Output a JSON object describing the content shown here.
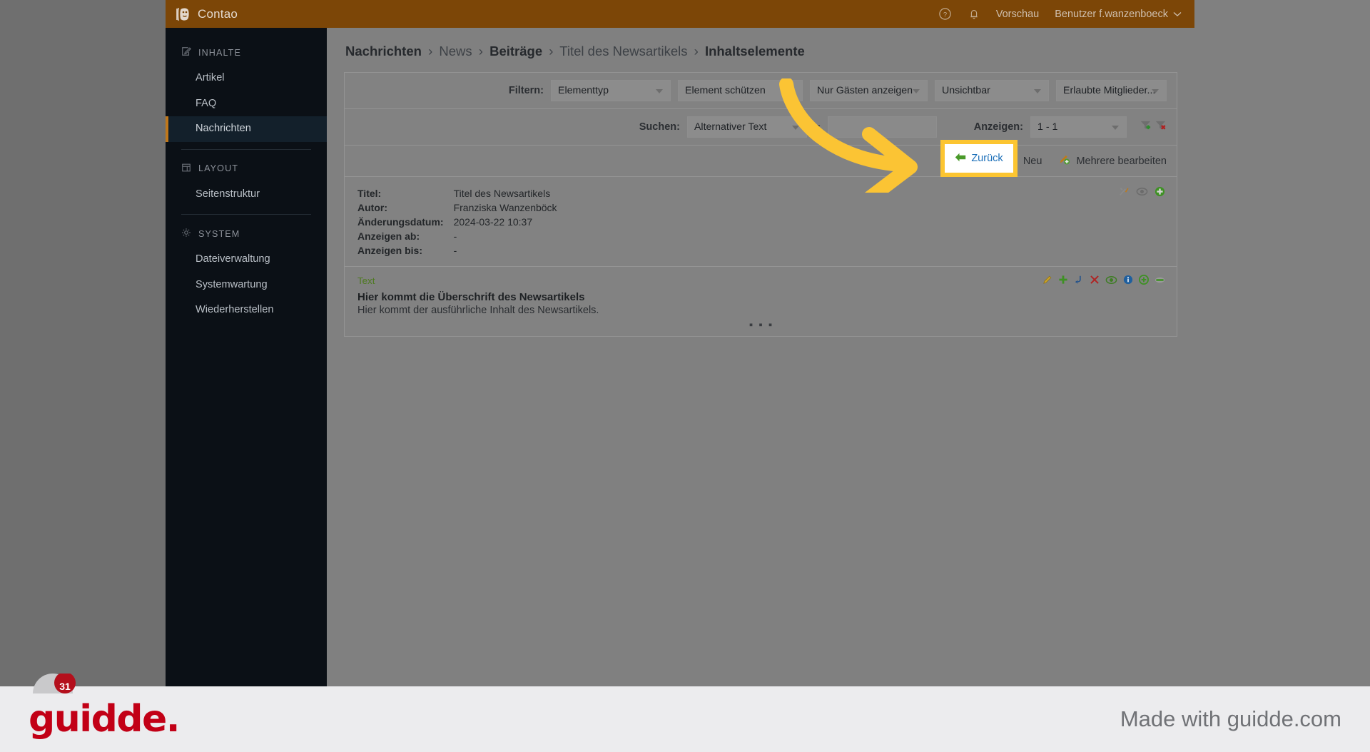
{
  "topbar": {
    "brand": "Contao",
    "brand_icon": "contao-logo-icon",
    "help_icon": "help-circle-icon",
    "notifications_icon": "bell-icon",
    "preview_label": "Vorschau",
    "user_label": "Benutzer f.wanzenboeck",
    "user_chevron_icon": "chevron-down-icon",
    "bg_color": "#7c4607"
  },
  "sidebar": {
    "groups": [
      {
        "label": "INHALTE",
        "icon": "pencil-square-icon",
        "items": [
          {
            "label": "Artikel",
            "active": false
          },
          {
            "label": "FAQ",
            "active": false
          },
          {
            "label": "Nachrichten",
            "active": true
          }
        ]
      },
      {
        "label": "LAYOUT",
        "icon": "layout-panel-icon",
        "items": [
          {
            "label": "Seitenstruktur",
            "active": false
          }
        ]
      },
      {
        "label": "SYSTEM",
        "icon": "gear-icon",
        "items": [
          {
            "label": "Dateiverwaltung",
            "active": false
          },
          {
            "label": "Systemwartung",
            "active": false
          },
          {
            "label": "Wiederherstellen",
            "active": false
          }
        ]
      }
    ],
    "active_accent_color": "#c0771a"
  },
  "breadcrumb": {
    "parts": [
      {
        "text": "Nachrichten",
        "strong": true
      },
      {
        "text": "News",
        "strong": false
      },
      {
        "text": "Beiträge",
        "strong": true
      },
      {
        "text": "Titel des Newsartikels",
        "strong": false
      },
      {
        "text": "Inhaltselemente",
        "strong": true
      }
    ],
    "separator": "›"
  },
  "filter_bar": {
    "label": "Filtern:",
    "selects": [
      {
        "value": "Elementtyp"
      },
      {
        "value": "Element schützen"
      },
      {
        "value": "Nur Gästen anzeigen"
      },
      {
        "value": "Unsichtbar"
      },
      {
        "value": "Erlaubte Mitglieder..."
      }
    ]
  },
  "search_bar": {
    "label": "Suchen:",
    "field_select": "Alternativer Text",
    "operator": "=",
    "input_value": "",
    "input_placeholder": "",
    "show_label": "Anzeigen:",
    "show_value": "1 - 1",
    "funnel_add_icon": "funnel-add-icon",
    "funnel_remove_icon": "funnel-remove-icon"
  },
  "actions": {
    "back": {
      "label": "Zurück",
      "icon": "arrow-left-icon",
      "highlighted": true
    },
    "new": {
      "label": "Neu",
      "icon": "plus-circle-icon"
    },
    "edit_multiple": {
      "label": "Mehrere bearbeiten",
      "icon": "multi-edit-icon"
    }
  },
  "record": {
    "meta": [
      {
        "key": "Titel:",
        "value": "Titel des Newsartikels"
      },
      {
        "key": "Autor:",
        "value": "Franziska Wanzenböck"
      },
      {
        "key": "Änderungsdatum:",
        "value": "2024-03-22 10:37"
      },
      {
        "key": "Anzeigen ab:",
        "value": "-"
      },
      {
        "key": "Anzeigen bis:",
        "value": "-"
      }
    ],
    "header_icons": [
      "toggle-nodes-icon",
      "toggle-visibility-icon",
      "add-circle-icon"
    ],
    "element": {
      "type_label": "Text",
      "headline": "Hier kommt die Überschrift des Newsartikels",
      "body": "Hier kommt der ausführliche Inhalt des Newsartikels.",
      "overflow_dots": "▪ ▪ ▪",
      "icons": [
        "edit-pencil-icon",
        "add-plus-icon",
        "duplicate-arrow-icon",
        "delete-x-icon",
        "toggle-visibility-icon",
        "info-icon",
        "add-circle-icon",
        "drag-handle-icon"
      ]
    }
  },
  "annotation": {
    "arrow_color": "#fbc434",
    "highlight_color": "#fcc531"
  },
  "footer": {
    "logo_text": "guidde.",
    "logo_color": "#c20016",
    "made_with": "Made with guidde.com",
    "badge_count": "31"
  }
}
